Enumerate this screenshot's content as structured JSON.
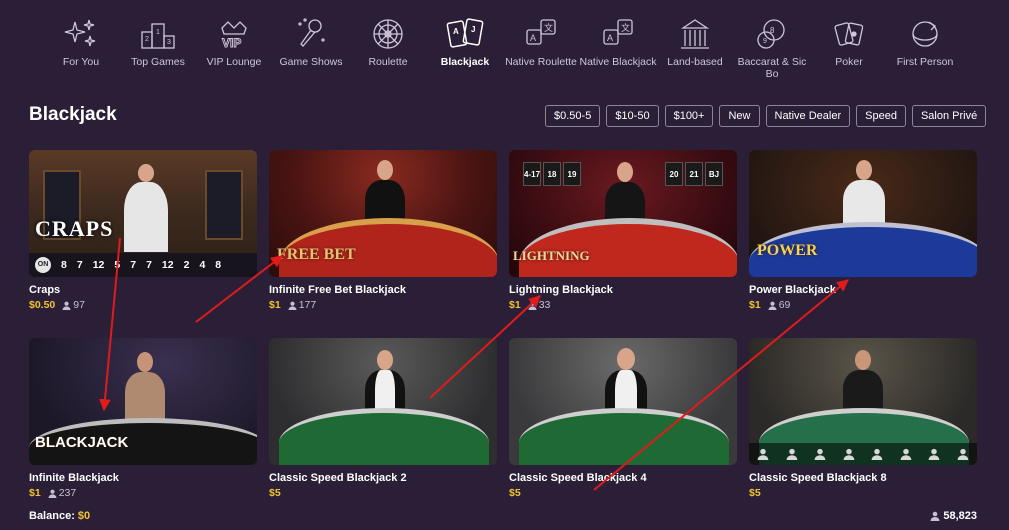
{
  "nav": [
    {
      "label": "For You",
      "icon": "sparkles-icon"
    },
    {
      "label": "Top Games",
      "icon": "podium-icon"
    },
    {
      "label": "VIP Lounge",
      "icon": "vip-icon"
    },
    {
      "label": "Game Shows",
      "icon": "microphone-icon"
    },
    {
      "label": "Roulette",
      "icon": "roulette-wheel-icon"
    },
    {
      "label": "Blackjack",
      "icon": "playing-cards-icon",
      "active": true
    },
    {
      "label": "Native Roulette",
      "icon": "language-icon"
    },
    {
      "label": "Native Blackjack",
      "icon": "language-icon"
    },
    {
      "label": "Land-based",
      "icon": "building-icon"
    },
    {
      "label": "Baccarat & Sic Bo",
      "icon": "chips-icon"
    },
    {
      "label": "Poker",
      "icon": "poker-cards-icon"
    },
    {
      "label": "First Person",
      "icon": "first-person-icon"
    }
  ],
  "page": {
    "title": "Blackjack"
  },
  "filters": [
    "$0.50-5",
    "$10-50",
    "$100+",
    "New",
    "Native Dealer",
    "Speed",
    "Salon Privé"
  ],
  "cards": [
    {
      "title": "Craps",
      "stake": "$0.50",
      "players": "97",
      "logo": "CRAPS",
      "history": [
        "ON",
        "8",
        "7",
        "12",
        "5",
        "7",
        "7",
        "12",
        "2",
        "4",
        "8"
      ]
    },
    {
      "title": "Infinite Free Bet Blackjack",
      "stake": "$1",
      "players": "177",
      "logo": "FREE BET"
    },
    {
      "title": "Lightning Blackjack",
      "stake": "$1",
      "players": "33",
      "logo": "LIGHTNING",
      "scores": [
        "4-17",
        "18",
        "19",
        "20",
        "21",
        "BJ"
      ]
    },
    {
      "title": "Power Blackjack",
      "stake": "$1",
      "players": "69",
      "logo": "POWER"
    },
    {
      "title": "Infinite Blackjack",
      "stake": "$1",
      "players": "237",
      "logo": "BLACKJACK"
    },
    {
      "title": "Classic Speed Blackjack 2",
      "stake": "$5",
      "players": ""
    },
    {
      "title": "Classic Speed Blackjack 4",
      "stake": "$5",
      "players": ""
    },
    {
      "title": "Classic Speed Blackjack 8",
      "stake": "$5",
      "players": ""
    }
  ],
  "footer": {
    "balance_label": "Balance:",
    "balance_value": "$0",
    "online_count": "58,823"
  },
  "colors": {
    "background": "#2a1f36",
    "stake": "#f1c232",
    "annotation_arrow": "#e01b1b"
  }
}
